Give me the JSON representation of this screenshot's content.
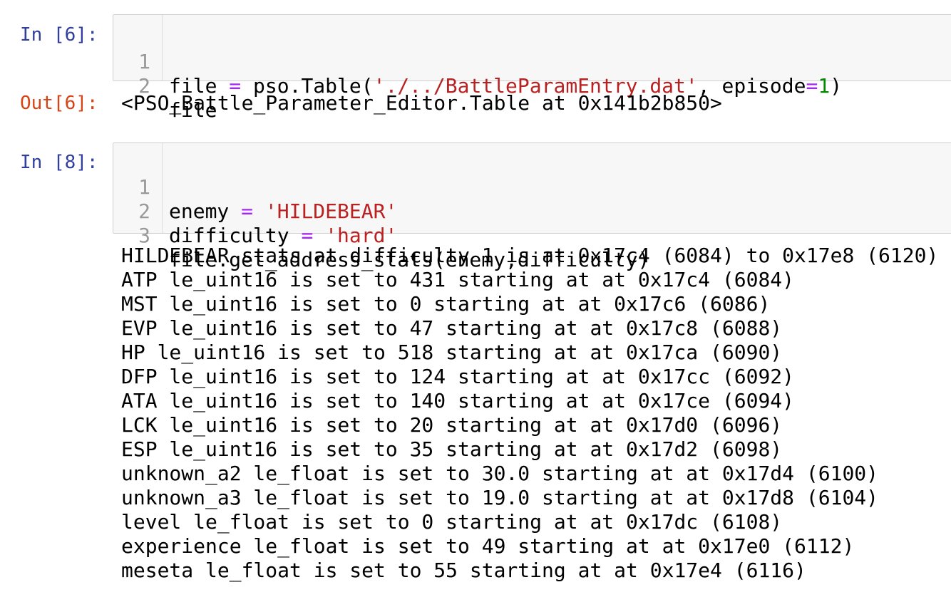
{
  "cells": {
    "in6": {
      "prompt": "In [6]:",
      "lines": [
        {
          "num": "1",
          "p1": "file ",
          "op1": "=",
          "p2": " pso.Table(",
          "str1": "'./../BattleParamEntry.dat'",
          "p3": ", episode",
          "op2": "=",
          "num1": "1",
          "p4": ")"
        },
        {
          "num": "2",
          "p1": "file"
        }
      ]
    },
    "out6": {
      "prompt": "Out[6]:",
      "text": "<PSO_Battle_Parameter_Editor.Table at 0x141b2b850>"
    },
    "in8": {
      "prompt": "In [8]:",
      "lines": [
        {
          "num": "1",
          "p1": "enemy ",
          "op1": "=",
          "p2": " ",
          "str1": "'HILDEBEAR'"
        },
        {
          "num": "2",
          "p1": "difficulty ",
          "op1": "=",
          "p2": " ",
          "str1": "'hard'"
        },
        {
          "num": "3",
          "p1": "file.get_address_stats(enemy,difficulty)"
        }
      ]
    },
    "stdout": [
      "HILDEBEAR stats at difficulty 1 is at 0x17c4 (6084) to 0x17e8 (6120)",
      "ATP le_uint16 is set to 431 starting at at 0x17c4 (6084)",
      "MST le_uint16 is set to 0 starting at at 0x17c6 (6086)",
      "EVP le_uint16 is set to 47 starting at at 0x17c8 (6088)",
      "HP le_uint16 is set to 518 starting at at 0x17ca (6090)",
      "DFP le_uint16 is set to 124 starting at at 0x17cc (6092)",
      "ATA le_uint16 is set to 140 starting at at 0x17ce (6094)",
      "LCK le_uint16 is set to 20 starting at at 0x17d0 (6096)",
      "ESP le_uint16 is set to 35 starting at at 0x17d2 (6098)",
      "unknown_a2 le_float is set to 30.0 starting at at 0x17d4 (6100)",
      "unknown_a3 le_float is set to 19.0 starting at at 0x17d8 (6104)",
      "level le_float is set to 0 starting at at 0x17dc (6108)",
      "experience le_float is set to 49 starting at at 0x17e0 (6112)",
      "meseta le_float is set to 55 starting at at 0x17e4 (6116)"
    ]
  },
  "colors": {
    "prompt_in": "#303f9f",
    "prompt_out": "#d84315",
    "string": "#ba2121",
    "operator": "#aa22ff",
    "number": "#008800",
    "input_bg": "#f7f7f7"
  }
}
